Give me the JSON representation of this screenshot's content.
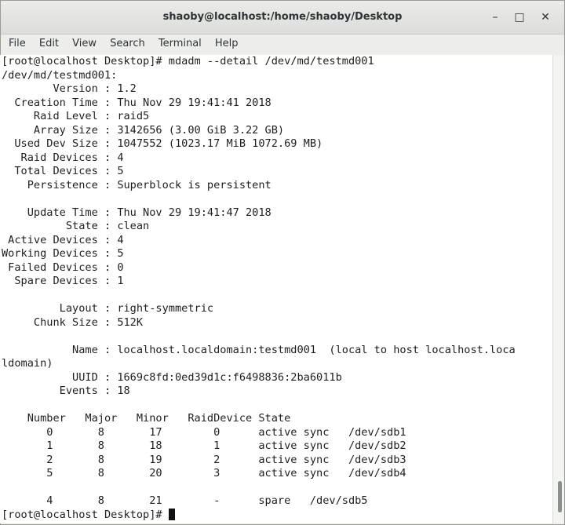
{
  "window": {
    "title": "shaoby@localhost:/home/shaoby/Desktop",
    "controls": {
      "minimize": "–",
      "maximize": "□",
      "close": "✕"
    }
  },
  "menu": [
    "File",
    "Edit",
    "View",
    "Search",
    "Terminal",
    "Help"
  ],
  "terminal": {
    "lines": [
      "[root@localhost Desktop]# mdadm --detail /dev/md/testmd001",
      "/dev/md/testmd001:",
      "        Version : 1.2",
      "  Creation Time : Thu Nov 29 19:41:41 2018",
      "     Raid Level : raid5",
      "     Array Size : 3142656 (3.00 GiB 3.22 GB)",
      "  Used Dev Size : 1047552 (1023.17 MiB 1072.69 MB)",
      "   Raid Devices : 4",
      "  Total Devices : 5",
      "    Persistence : Superblock is persistent",
      "",
      "    Update Time : Thu Nov 29 19:41:47 2018",
      "          State : clean",
      " Active Devices : 4",
      "Working Devices : 5",
      " Failed Devices : 0",
      "  Spare Devices : 1",
      "",
      "         Layout : right-symmetric",
      "     Chunk Size : 512K",
      "",
      "           Name : localhost.localdomain:testmd001  (local to host localhost.loca",
      "ldomain)",
      "           UUID : 1669c8fd:0ed39d1c:f6498836:2ba6011b",
      "         Events : 18",
      "",
      "    Number   Major   Minor   RaidDevice State",
      "       0       8       17        0      active sync   /dev/sdb1",
      "       1       8       18        1      active sync   /dev/sdb2",
      "       2       8       19        2      active sync   /dev/sdb3",
      "       5       8       20        3      active sync   /dev/sdb4",
      "",
      "       4       8       21        -      spare   /dev/sdb5"
    ],
    "prompt": "[root@localhost Desktop]# "
  }
}
